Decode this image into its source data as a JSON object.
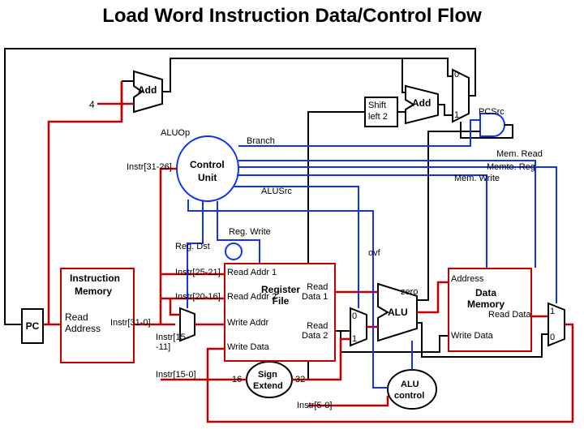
{
  "title": "Load Word Instruction Data/Control Flow",
  "constants": {
    "four": "4",
    "one": "1",
    "zero": "0",
    "sixteen": "16",
    "thirtytwo": "32"
  },
  "blocks": {
    "pc": "PC",
    "imem_l1": "Instruction",
    "imem_l2": "Memory",
    "read_addr": "Read\nAddress",
    "instr_bus": "Instr[31-0]",
    "add1": "Add",
    "add2": "Add",
    "shift_l1": "Shift",
    "shift_l2": "left 2",
    "control_l1": "Control",
    "control_l2": "Unit",
    "reg_ra1": "Read Addr 1",
    "reg_ra2": "Read Addr 2",
    "reg_wa": "Write Addr",
    "reg_wd": "Write Data",
    "reg_rd1": "Read\nData 1",
    "reg_rd2": "Read\nData 2",
    "reg_title": "Register\nFile",
    "signext_l1": "Sign",
    "signext_l2": "Extend",
    "alu": "ALU",
    "aluctrl_l1": "ALU",
    "aluctrl_l2": "control",
    "dmem_title": "Data\nMemory",
    "dmem_addr": "Address",
    "dmem_wd": "Write Data",
    "dmem_rd": "Read Data"
  },
  "signals": {
    "aluop": "ALUOp",
    "branch": "Branch",
    "alusrc": "ALUSrc",
    "regwrite": "Reg. Write",
    "regdst": "Reg. Dst",
    "pcsrc": "PCSrc",
    "memread": "Mem. Read",
    "memwrite": "Mem. Write",
    "memtoreg": "Memto. Reg",
    "ovf": "ovf",
    "zero": "zero"
  },
  "fields": {
    "f31_26": "Instr[31-26]",
    "f25_21": "Instr[25-21]",
    "f20_16": "Instr[20-16]",
    "f15_11": "Instr[15\n-11]",
    "f15_0": "Instr[15-0]",
    "f5_0": "Instr[5-0]"
  }
}
